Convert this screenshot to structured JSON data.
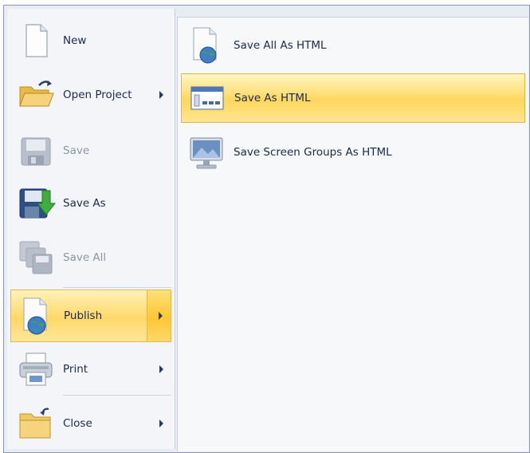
{
  "left_menu": [
    {
      "label": "New",
      "icon": "new-document-icon",
      "disabled": false,
      "submenu": false
    },
    {
      "label": "Open Project",
      "icon": "open-folder-icon",
      "disabled": false,
      "submenu": true
    },
    {
      "label": "Save",
      "icon": "save-disk-icon",
      "disabled": true,
      "submenu": false
    },
    {
      "label": "Save As",
      "icon": "save-as-icon",
      "disabled": false,
      "submenu": false
    },
    {
      "label": "Save All",
      "icon": "save-all-icon",
      "disabled": true,
      "submenu": false
    },
    {
      "label": "Publish",
      "icon": "publish-globe-icon",
      "disabled": false,
      "submenu": true,
      "selected": true
    },
    {
      "label": "Print",
      "icon": "printer-icon",
      "disabled": false,
      "submenu": true
    },
    {
      "label": "Close",
      "icon": "close-folder-icon",
      "disabled": false,
      "submenu": true
    }
  ],
  "submenu": [
    {
      "label": "Save All As HTML",
      "icon": "globe-document-icon"
    },
    {
      "label": "Save As HTML",
      "icon": "html-window-icon",
      "highlighted": true
    },
    {
      "label": "Save Screen Groups As HTML",
      "icon": "monitor-screen-icon"
    }
  ],
  "colors": {
    "highlight": "#ffd86a",
    "menu_bg": "#f3f5f9",
    "text": "#1c2a4b"
  }
}
